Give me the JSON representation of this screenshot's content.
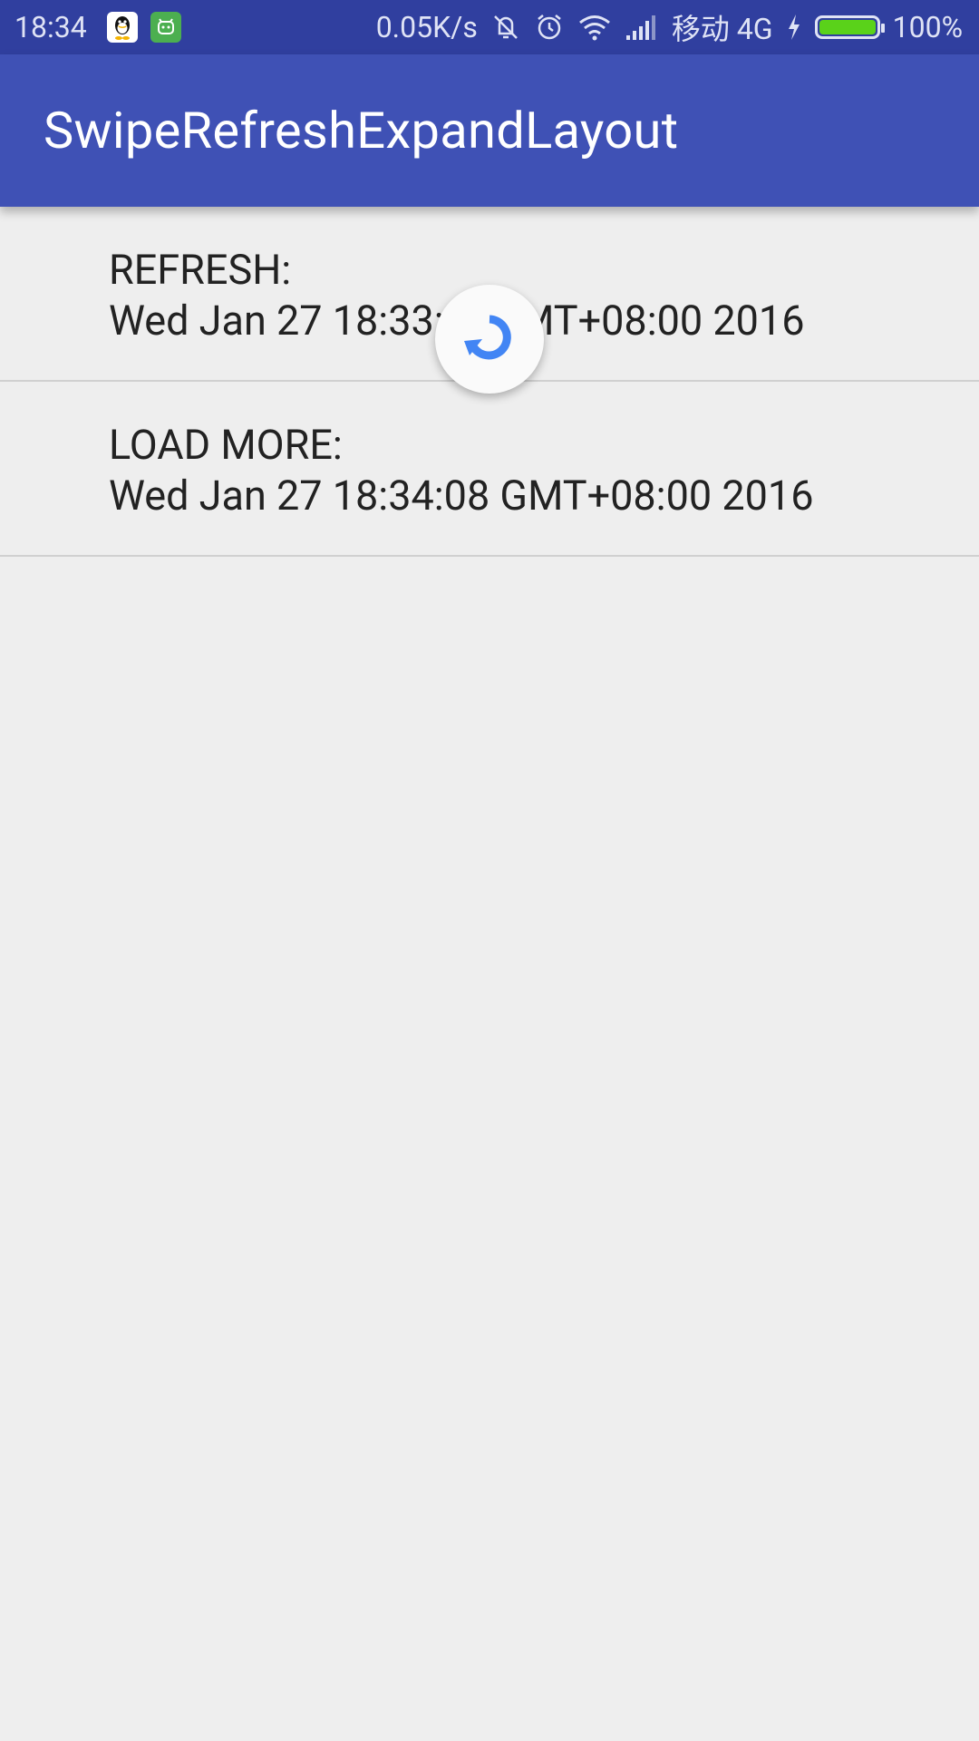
{
  "status_bar": {
    "time": "18:34",
    "network_speed": "0.05K/s",
    "carrier": "移动 4G",
    "battery_percent": "100%",
    "accent_color": "#303f9f"
  },
  "app_bar": {
    "title": "SwipeRefreshExpandLayout",
    "color": "#3f51b5"
  },
  "list": {
    "items": [
      {
        "label": "REFRESH:",
        "value": "Wed Jan 27 18:33:__ GMT+08:00 2016"
      },
      {
        "label": "LOAD MORE:",
        "value": "Wed Jan 27 18:34:08 GMT+08:00 2016"
      }
    ]
  },
  "refresh_indicator": {
    "icon": "refresh-icon",
    "color": "#4285f4"
  }
}
